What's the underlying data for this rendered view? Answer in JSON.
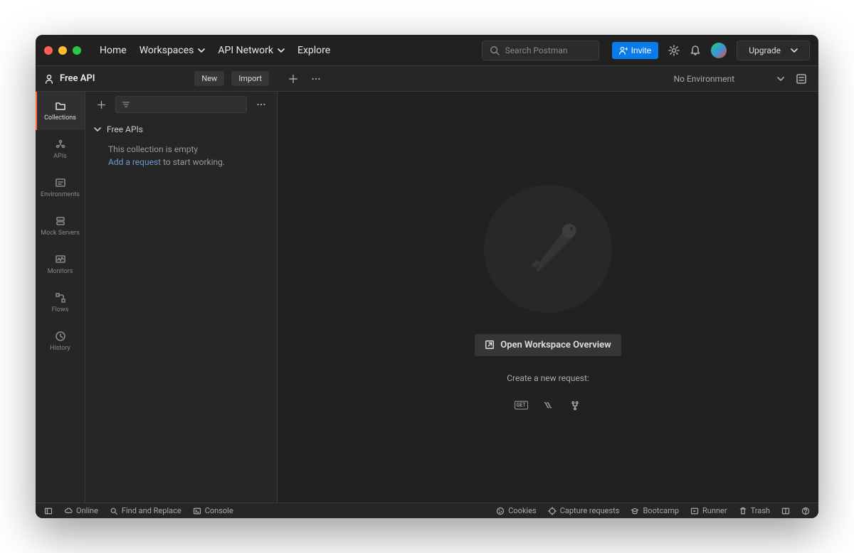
{
  "header": {
    "nav": {
      "home": "Home",
      "workspaces": "Workspaces",
      "api_network": "API Network",
      "explore": "Explore"
    },
    "search_placeholder": "Search Postman",
    "invite": "Invite",
    "upgrade": "Upgrade"
  },
  "subheader": {
    "workspace": "Free API",
    "new": "New",
    "import": "Import",
    "environment": "No Environment"
  },
  "leftrail": {
    "items": [
      {
        "label": "Collections"
      },
      {
        "label": "APIs"
      },
      {
        "label": "Environments"
      },
      {
        "label": "Mock Servers"
      },
      {
        "label": "Monitors"
      },
      {
        "label": "Flows"
      },
      {
        "label": "History"
      }
    ]
  },
  "sidebar": {
    "folder": "Free APIs",
    "empty_msg": "This collection is empty",
    "add_link": "Add a request",
    "add_suffix": " to start working."
  },
  "main": {
    "overview_btn": "Open Workspace Overview",
    "create_label": "Create a new request:",
    "get_label": "GET"
  },
  "footer": {
    "online": "Online",
    "find": "Find and Replace",
    "console": "Console",
    "cookies": "Cookies",
    "capture": "Capture requests",
    "bootcamp": "Bootcamp",
    "runner": "Runner",
    "trash": "Trash"
  }
}
